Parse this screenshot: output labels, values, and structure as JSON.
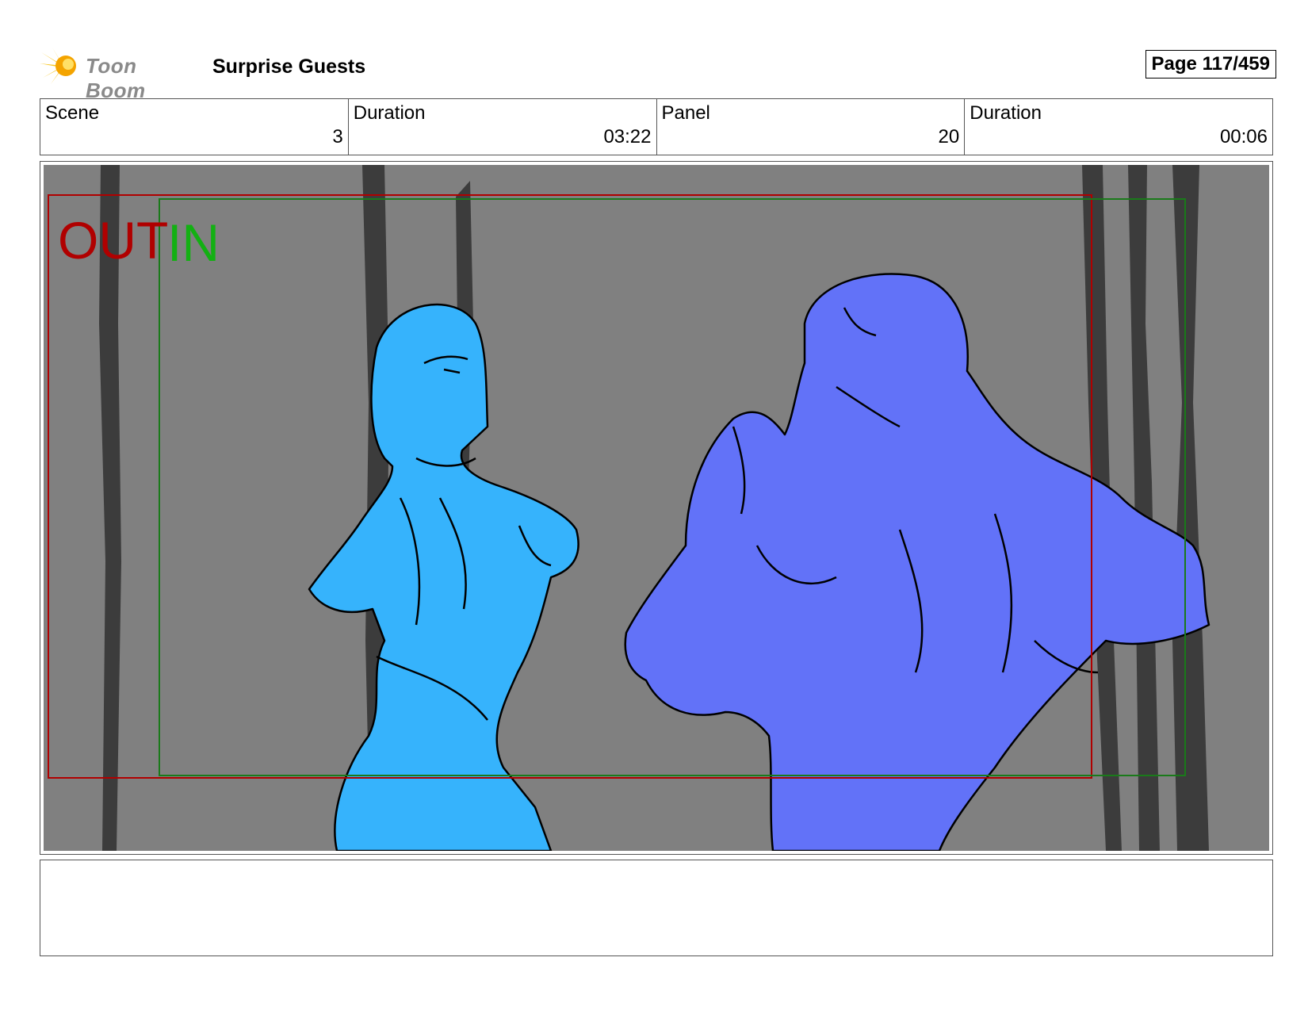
{
  "header": {
    "logo_text": "Toon Boom",
    "project_title": "Surprise Guests",
    "page_label": "Page 117/459"
  },
  "info": {
    "scene_label": "Scene",
    "scene_value": "3",
    "scene_duration_label": "Duration",
    "scene_duration_value": "03:22",
    "panel_label": "Panel",
    "panel_value": "20",
    "panel_duration_label": "Duration",
    "panel_duration_value": "00:06"
  },
  "panel": {
    "out_label": "OUT",
    "in_label": "IN",
    "colors": {
      "background": "#808080",
      "tree": "#3c3c3c",
      "woman_fill": "#36b3fc",
      "man_fill": "#6272f8",
      "out_frame": "#b00000",
      "in_frame": "#1a7a1a"
    }
  },
  "notes": {
    "text": ""
  }
}
